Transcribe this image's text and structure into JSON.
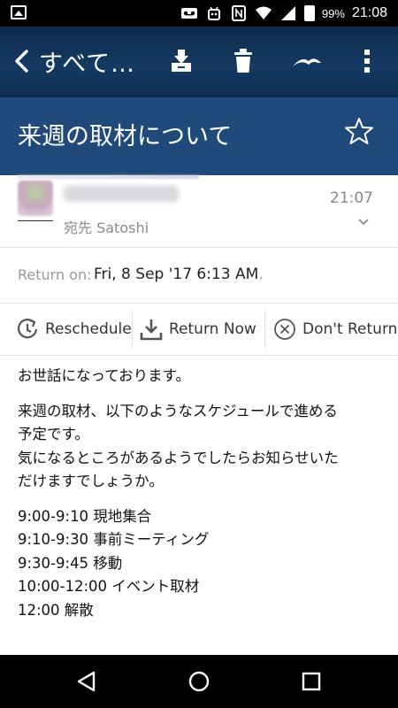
{
  "status_bar": {
    "battery": "99%",
    "time": "21:08",
    "icons": [
      "image-icon",
      "voicemail-icon",
      "android-icon",
      "nfc-icon",
      "wifi-icon",
      "signal-icon",
      "battery-icon"
    ]
  },
  "toolbar": {
    "title": "すべて…",
    "actions": [
      "archive-icon",
      "trash-icon",
      "swipe-icon",
      "more-icon"
    ]
  },
  "subject": {
    "title": "来週の取材について"
  },
  "sender": {
    "to": "宛先 Satoshi",
    "time": "21:07"
  },
  "return_info": {
    "label": "Return on:",
    "value": "Fri, 8 Sep '17 6:13 AM",
    "dot": "."
  },
  "actions": {
    "reschedule": "Reschedule",
    "return_now": "Return Now",
    "dont_return": "Don't Return"
  },
  "message": {
    "greeting": "お世話になっております。",
    "p2_l1": "来週の取材、以下のようなスケジュールで進める",
    "p2_l2": "予定です。",
    "p2_l3": "気になるところがあるようでしたらお知らせいた",
    "p2_l4": "だけますでしょうか。",
    "schedule": [
      "9:00-9:10 現地集合",
      "9:10-9:30 事前ミーティング",
      "9:30-9:45 移動",
      "10:00-12:00 イベント取材",
      "12:00 解散"
    ]
  },
  "colors": {
    "toolbar": "#123660",
    "subject_bar": "#1f4a7a",
    "accent": "#ffffff"
  }
}
